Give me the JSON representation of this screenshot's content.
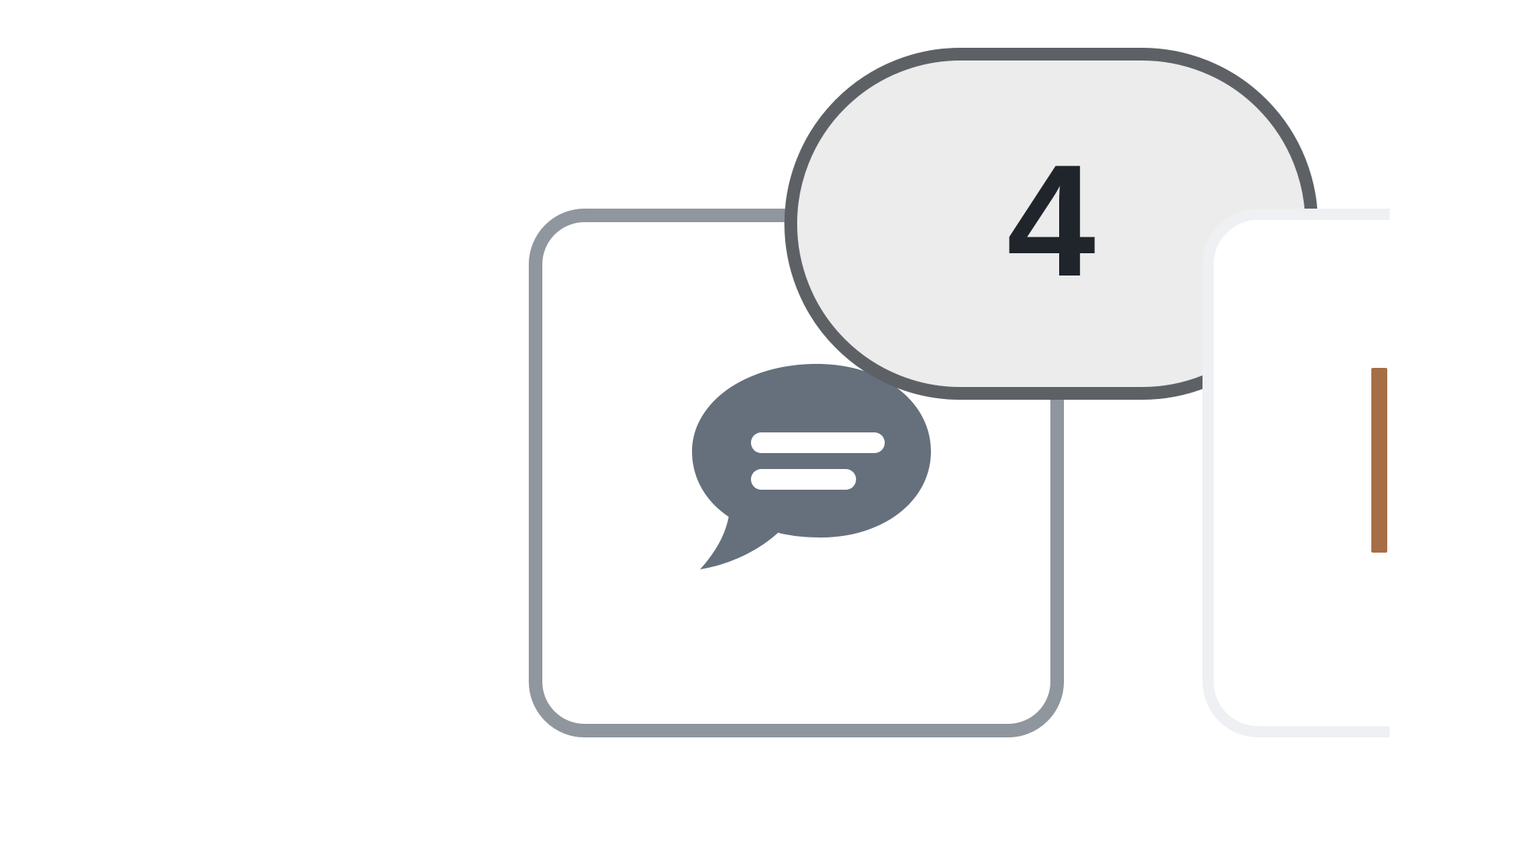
{
  "chat_button": {
    "icon": "chat-bubble-icon",
    "badge": {
      "count": "4"
    }
  },
  "next_button": {
    "icon": "text-cursor-icon",
    "accent_color": "#a56e46"
  },
  "colors": {
    "button_border": "#8f969d",
    "icon_fill": "#65707c",
    "badge_fill": "#ececec",
    "badge_border": "#5d6166",
    "badge_text": "#1f252b"
  }
}
